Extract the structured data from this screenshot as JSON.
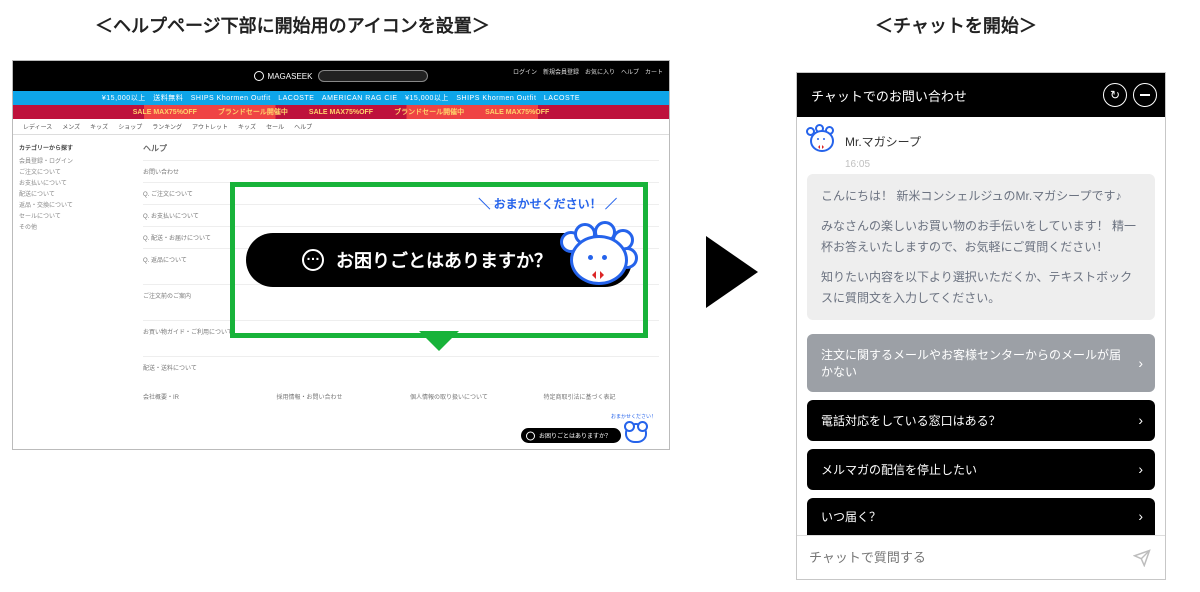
{
  "captions": {
    "left": "＜ヘルプページ下部に開始用のアイコンを設置＞",
    "right": "＜チャットを開始＞"
  },
  "left_page": {
    "brand": "MAGASEEK",
    "top_links": "ログイン　新規会員登録　お気に入り　ヘルプ　カート",
    "blue_banner": "¥15,000以上　送料無料　SHIPS Khormen Outfit　LACOSTE　AMERICAN RAG CIE　¥15,000以上　SHIPS Khormen Outfit　LACOSTE",
    "red_banner": "SALE  MAX75%OFF　　　ブランドセール開催中　　　SALE  MAX75%OFF　　　ブランドセール開催中　　　SALE  MAX75%OFF",
    "nav_items": [
      "レディース",
      "メンズ",
      "キッズ",
      "ショップ",
      "ランキング",
      "アウトレット",
      "キッズ",
      "セール",
      "ヘルプ"
    ],
    "side_title": "カテゴリーから探す",
    "side_items": [
      "会員登録・ログイン",
      "ご注文について",
      "お支払いについて",
      "配送について",
      "返品・交換について",
      "セールについて",
      "その他"
    ],
    "help_title": "ヘルプ",
    "help_sub1": "お問い合わせ",
    "help_rows": [
      "Q. ご注文について",
      "Q. お支払いについて",
      "Q. 配送・お届けについて",
      "Q. 返品について"
    ],
    "section2": "ご注文前のご案内",
    "section3": "お買い物ガイド・ご利用について",
    "section4": "配送・送料について",
    "footer_cols": [
      "会社概要・IR",
      "採用情報・お問い合わせ",
      "個人情報の取り扱いについて",
      "特定商取引法に基づく表記"
    ],
    "cta_mini_bubble": "おまかせください！",
    "cta_mini_pill": "お困りごとはありますか？"
  },
  "highlight": {
    "bubble": "＼ おまかせください！ ／",
    "pill": "お困りごとはありますか？"
  },
  "chat": {
    "header": "チャットでのお問い合わせ",
    "reload_icon_label": "↻",
    "bot_name": "Mr.マガシープ",
    "timestamp": "16:05",
    "message_p1": "こんにちは！\n新米コンシェルジュのMr.マガシープです♪",
    "message_p2": "みなさんの楽しいお買い物のお手伝いをしています！\n精一杯お答えいたしますので、お気軽にご質問ください！",
    "message_p3": "知りたい内容を以下より選択いただくか、テキストボックスに質問文を入力してください。",
    "options": [
      "注文に関するメールやお客様センターからのメールが届かない",
      "電話対応をしている窓口はある？",
      "メルマガの配信を停止したい",
      "いつ届く？"
    ],
    "input_placeholder": "チャットで質問する"
  }
}
